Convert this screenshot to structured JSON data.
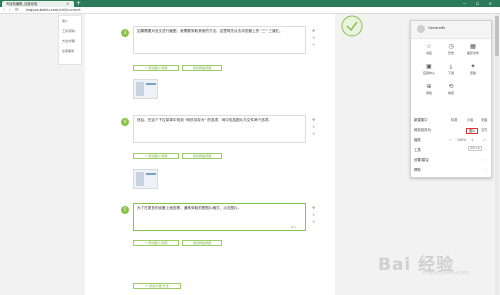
{
  "browser": {
    "tab_title": "写经验编辑_百度经验",
    "tab_close": "×",
    "new_tab": "+",
    "window_controls": "— ☐ ✕",
    "url_host": "jingyan.baidu.com",
    "url_path": "/edit/content",
    "back_icon": "‹",
    "forward_icon": "›",
    "refresh_icon": "⟳",
    "lock_icon": "🔒"
  },
  "left_nav": {
    "items": [
      "简介",
      "工具/原料",
      "方法/步骤",
      "注意事项"
    ]
  },
  "steps": [
    {
      "num": "3",
      "text": "如果需要对全文进行截图，就需要采取其他的方法。这里再先点击浏览器上的 \"三\" 三道杠。",
      "insert_image": "+ 添加图片/视频",
      "insert_subtitle": "添加网络视频"
    },
    {
      "num": "4",
      "text": "然后，在这个下拉菜单中找到 \"网页另存为\" 的选项，网中包括图片与文件两个选项。",
      "insert_image": "+ 添加图片/视频",
      "insert_subtitle": "添加网络视频"
    },
    {
      "num": "5",
      "text": "为了在更多的设备上面查看，通常采取的是图片格式，点击图片。",
      "insert_image": "+ 添加图片/视频",
      "insert_subtitle": "添加网络视频",
      "counter": "0 ▯"
    }
  ],
  "step_tools": {
    "move": "✥",
    "close": "×",
    "add": "+"
  },
  "add_step_button": "+ 添加步骤/方法",
  "menu": {
    "user_name": "GeneralKr",
    "grid": [
      {
        "icon": "☆",
        "label": "书签"
      },
      {
        "icon": "◷",
        "label": "历史"
      },
      {
        "icon": "▦",
        "label": "缓存文件"
      },
      {
        "icon": "▣",
        "label": "应用中心"
      },
      {
        "icon": "⤓",
        "label": "下载"
      },
      {
        "icon": "✦",
        "label": "皮肤"
      },
      {
        "icon": "⊕",
        "label": "添加"
      },
      {
        "icon": "⟲",
        "label": "恢复"
      }
    ],
    "rows": {
      "new_window": "新建窗口",
      "new_window_opts": [
        "标准",
        "小窗",
        "无痕"
      ],
      "save_page": "网页另存为",
      "save_page_opts": [
        "图片",
        "文件"
      ],
      "zoom_label": "缩放",
      "zoom_value": "100%",
      "tools": "工具",
      "settings": "设置/建议",
      "help": "帮助"
    },
    "tooltip": "(Ctrl+S)",
    "chevron": "›"
  },
  "watermark": {
    "main": "Bai 经验",
    "sub": "jingyan.baidu.com"
  },
  "colors": {
    "accent": "#8bc34a",
    "tabbar": "#2b7a5a",
    "highlight": "#e0352b"
  }
}
